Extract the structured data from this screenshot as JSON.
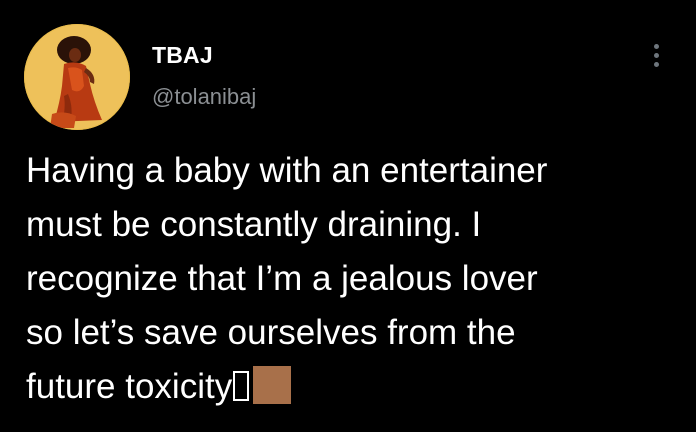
{
  "author": {
    "display_name": "TBAJ",
    "handle": "@tolanibaj"
  },
  "tweet": {
    "lines": [
      "Having a baby with an entertainer",
      "must be constantly draining. I",
      "recognize that I’m a jealous lover",
      "so let’s save ourselves from the",
      "future toxicity"
    ],
    "trailing_emoji": [
      "missing-glyph-box",
      "skin-tone-modifier-medium-dark"
    ]
  },
  "icons": {
    "more": "vertical-ellipsis-icon"
  },
  "colors": {
    "background": "#000000",
    "text": "#ffffff",
    "handle": "#8b8f93",
    "avatar_bg": "#e7b94a",
    "skin_tone": "#a8704a"
  }
}
